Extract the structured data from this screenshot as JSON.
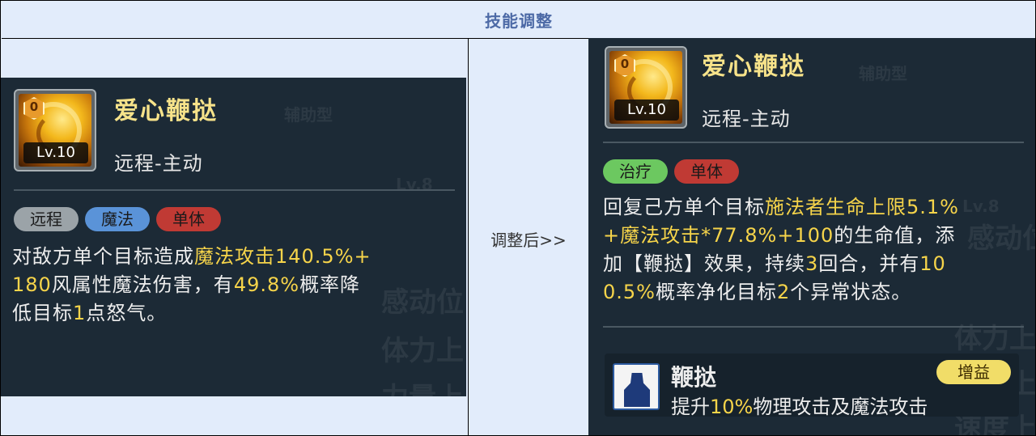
{
  "header": {
    "title": "技能调整"
  },
  "middle": {
    "label": "调整后>>"
  },
  "left": {
    "icon": {
      "level_num": "0",
      "level": "Lv.10"
    },
    "name": "爱心鞭挞",
    "type": "远程-主动",
    "tags": [
      "远程",
      "魔法",
      "单体"
    ],
    "desc": [
      {
        "t": "对敌方单个目标造成",
        "h": false
      },
      {
        "t": "魔法攻击140.5%+",
        "h": true
      },
      {
        "t": "180",
        "h": true
      },
      {
        "t": "风属性魔法伤害，有",
        "h": false
      },
      {
        "t": "49.8%",
        "h": true
      },
      {
        "t": "概率降",
        "h": false
      },
      {
        "t": "低目标",
        "h": false
      },
      {
        "t": "1",
        "h": true
      },
      {
        "t": "点怒气。",
        "h": false
      }
    ],
    "watermarks": [
      "辅助型",
      "Lv.8",
      "感动位",
      "体力上",
      "力量上"
    ]
  },
  "right": {
    "icon": {
      "level_num": "0",
      "level": "Lv.10"
    },
    "name": "爱心鞭挞",
    "type": "远程-主动",
    "tags": [
      "治疗",
      "单体"
    ],
    "desc": [
      {
        "t": "回复己方单个目标",
        "h": false
      },
      {
        "t": "施法者生命上限5.1%",
        "h": true
      },
      {
        "t": "+魔法攻击*77.8%+100",
        "h": true
      },
      {
        "t": "的生命值，添",
        "h": false
      },
      {
        "t": "加【鞭挞】效果，持续",
        "h": false
      },
      {
        "t": "3",
        "h": true
      },
      {
        "t": "回合，并有",
        "h": false
      },
      {
        "t": "10",
        "h": true
      },
      {
        "t": "0.5%",
        "h": true
      },
      {
        "t": "概率净化目标",
        "h": false
      },
      {
        "t": "2",
        "h": true
      },
      {
        "t": "个异常状态。",
        "h": false
      }
    ],
    "buff": {
      "name": "鞭挞",
      "badge": "增益",
      "desc_pre": "提升",
      "desc_hl": "10%",
      "desc_post": "物理攻击及魔法攻击"
    },
    "watermarks": [
      "辅助型",
      "Lv.8",
      "感动位",
      "体力上",
      "力量上",
      "速度上"
    ]
  },
  "colors": {
    "highlight": "#f6d44a",
    "name": "#f7e38a",
    "title": "#4d6aa6"
  }
}
